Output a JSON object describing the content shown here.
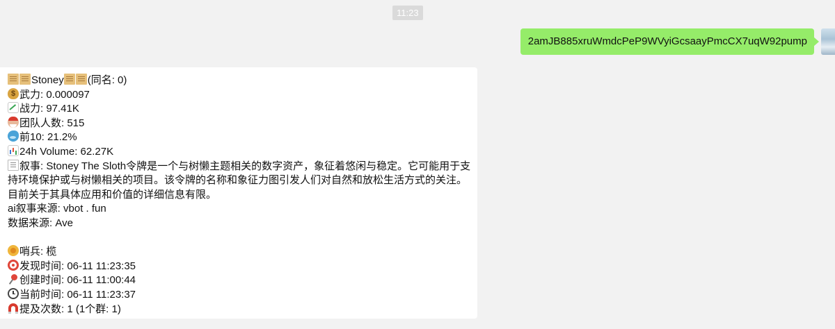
{
  "timestamp": "11:23",
  "outgoing": {
    "text": "2amJB885xruWmdcPeP9WVyiGcsaayPmcCX7uqW92pump"
  },
  "incoming": {
    "title_name": "Stoney",
    "title_suffix": "(同名: 0)",
    "lines": {
      "price": "武力: 0.000097",
      "mcap": "战力: 97.41K",
      "holders": "团队人数: 515",
      "top10": "前10: 21.2%",
      "volume": "24h Volume: 62.27K",
      "narrative": "叙事: Stoney The Sloth令牌是一个与树懒主题相关的数字资产，象征着悠闲与稳定。它可能用于支持环境保护或与树懒相关的项目。该令牌的名称和象征力图引发人们对自然和放松生活方式的关注。目前关于其具体应用和价值的详细信息有限。",
      "ai_source": "ai叙事来源: vbot . fun",
      "data_source": "数据来源: Ave",
      "scout": "哨兵: 榄",
      "found_time": "发现时间: 06-11 11:23:35",
      "created_time": "创建时间: 06-11 11:00:44",
      "current_time": "当前时间: 06-11 11:23:37",
      "mentions": "提及次数: 1 (1个群: 1)"
    },
    "icons": {
      "title_left": "scroll-icon",
      "title_right": "scroll-icon",
      "price": "money-bag-icon",
      "mcap": "chart-increasing-icon",
      "holders": "santa-icon",
      "top10": "whale-icon",
      "volume": "bar-chart-icon",
      "narrative": "memo-icon",
      "scout": "medal-icon",
      "found_time": "target-icon",
      "created_time": "pushpin-icon",
      "current_time": "clock-icon",
      "mentions": "magnet-icon"
    }
  },
  "colors": {
    "background": "#f2f2f2",
    "outgoing_bubble": "#95ec69",
    "incoming_bubble": "#ffffff",
    "timestamp_bg": "#dadada"
  }
}
